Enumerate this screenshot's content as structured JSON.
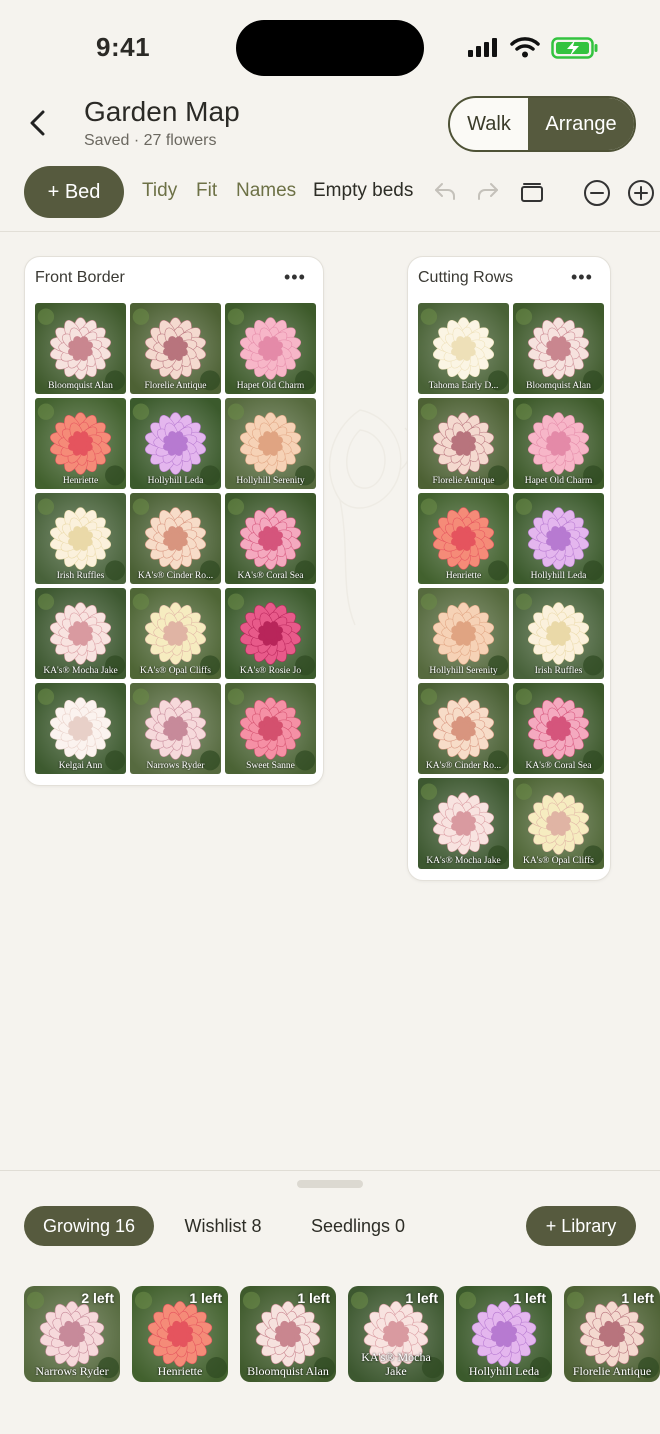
{
  "status": {
    "time": "9:41"
  },
  "header": {
    "title": "Garden Map",
    "subtitle": "Saved · 27 flowers",
    "mode_walk": "Walk",
    "mode_arrange": "Arrange"
  },
  "toolbar": {
    "add_bed": "+ Bed",
    "tidy": "Tidy",
    "fit": "Fit",
    "names": "Names",
    "empty_beds": "Empty beds"
  },
  "beds": [
    {
      "title": "Front Border",
      "more": "•••",
      "tiles": [
        {
          "label": "Bloomquist Alan",
          "c1": "#f6e2de",
          "c2": "#c9868f",
          "bg": "#3f5a2c"
        },
        {
          "label": "Florelie Antique",
          "c1": "#f4d9cf",
          "c2": "#b8747d",
          "bg": "#4d6134"
        },
        {
          "label": "Hapet Old Charm",
          "c1": "#f7b6c8",
          "c2": "#e48aa8",
          "bg": "#3d5a2a"
        },
        {
          "label": "Henriette",
          "c1": "#f58b78",
          "c2": "#e5545e",
          "bg": "#42612e"
        },
        {
          "label": "Hollyhill Leda",
          "c1": "#e4b6ee",
          "c2": "#b77ad1",
          "bg": "#3b5a2c"
        },
        {
          "label": "Hollyhill Serenity",
          "c1": "#f6d2b6",
          "c2": "#e0a482",
          "bg": "#566a3e"
        },
        {
          "label": "Irish Ruffles",
          "c1": "#fbf1dc",
          "c2": "#ead9a8",
          "bg": "#48623a"
        },
        {
          "label": "KA's® Cinder Ro...",
          "c1": "#f7dcc8",
          "c2": "#d8957f",
          "bg": "#4a6034"
        },
        {
          "label": "KA's® Coral Sea",
          "c1": "#f4a9bf",
          "c2": "#d5557c",
          "bg": "#3c582b"
        },
        {
          "label": "KA's® Mocha Jake",
          "c1": "#f8e3e0",
          "c2": "#d99aa0",
          "bg": "#3d5830"
        },
        {
          "label": "KA's® Opal Cliffs",
          "c1": "#f6ecc0",
          "c2": "#e0b4a4",
          "bg": "#4f6636"
        },
        {
          "label": "KA's® Rosie Jo",
          "c1": "#e85a8a",
          "c2": "#b8255a",
          "bg": "#3b5a2c"
        },
        {
          "label": "Kelgai Ann",
          "c1": "#fbf3ef",
          "c2": "#e8d0c8",
          "bg": "#3d5a2f"
        },
        {
          "label": "Narrows Ryder",
          "c1": "#f6d9db",
          "c2": "#c78a9a",
          "bg": "#566a3f"
        },
        {
          "label": "Sweet Sanne",
          "c1": "#f590a5",
          "c2": "#d4506e",
          "bg": "#4b6335"
        }
      ]
    },
    {
      "title": "Cutting Rows",
      "more": "•••",
      "tiles": [
        {
          "label": "Tahoma Early D...",
          "c1": "#fbf5e4",
          "c2": "#eee0b8",
          "bg": "#496236"
        },
        {
          "label": "Bloomquist Alan",
          "c1": "#f6e2de",
          "c2": "#c9868f",
          "bg": "#3f5a2c"
        },
        {
          "label": "Florelie Antique",
          "c1": "#f4d9cf",
          "c2": "#b8747d",
          "bg": "#4d6134"
        },
        {
          "label": "Hapet Old Charm",
          "c1": "#f7b6c8",
          "c2": "#e48aa8",
          "bg": "#3d5a2a"
        },
        {
          "label": "Henriette",
          "c1": "#f58b78",
          "c2": "#e5545e",
          "bg": "#42612e"
        },
        {
          "label": "Hollyhill Leda",
          "c1": "#e4b6ee",
          "c2": "#b77ad1",
          "bg": "#3b5a2c"
        },
        {
          "label": "Hollyhill Serenity",
          "c1": "#f6d2b6",
          "c2": "#e0a482",
          "bg": "#566a3e"
        },
        {
          "label": "Irish Ruffles",
          "c1": "#fbf1dc",
          "c2": "#ead9a8",
          "bg": "#48623a"
        },
        {
          "label": "KA's® Cinder Ro...",
          "c1": "#f7dcc8",
          "c2": "#d8957f",
          "bg": "#4a6034"
        },
        {
          "label": "KA's® Coral Sea",
          "c1": "#f4a9bf",
          "c2": "#d5557c",
          "bg": "#3c582b"
        },
        {
          "label": "KA's® Mocha Jake",
          "c1": "#f8e3e0",
          "c2": "#d99aa0",
          "bg": "#3d5830"
        },
        {
          "label": "KA's® Opal Cliffs",
          "c1": "#f6ecc0",
          "c2": "#e0b4a4",
          "bg": "#4f6636"
        }
      ]
    }
  ],
  "sheet": {
    "tab_growing": "Growing 16",
    "tab_wishlist": "Wishlist 8",
    "tab_seedlings": "Seedlings 0",
    "library": "+ Library",
    "cards": [
      {
        "badge": "2 left",
        "label": "Narrows Ryder",
        "c1": "#f6d9db",
        "c2": "#c78a9a",
        "bg": "#566a3f"
      },
      {
        "badge": "1 left",
        "label": "Henriette",
        "c1": "#f58b78",
        "c2": "#e5545e",
        "bg": "#42612e"
      },
      {
        "badge": "1 left",
        "label": "Bloomquist Alan",
        "c1": "#f6e2de",
        "c2": "#c9868f",
        "bg": "#3f5a2c"
      },
      {
        "badge": "1 left",
        "label": "KA's® Mocha Jake",
        "c1": "#f8e3e0",
        "c2": "#d99aa0",
        "bg": "#3d5830"
      },
      {
        "badge": "1 left",
        "label": "Hollyhill Leda",
        "c1": "#e4b6ee",
        "c2": "#b77ad1",
        "bg": "#3b5a2c"
      },
      {
        "badge": "1 left",
        "label": "Florelie Antique",
        "c1": "#f4d9cf",
        "c2": "#b8747d",
        "bg": "#4d6134"
      }
    ]
  },
  "colors": {
    "accent": "#565a3e",
    "background": "#f5f3ee",
    "card": "#ffffff",
    "link": "#6d7146"
  }
}
